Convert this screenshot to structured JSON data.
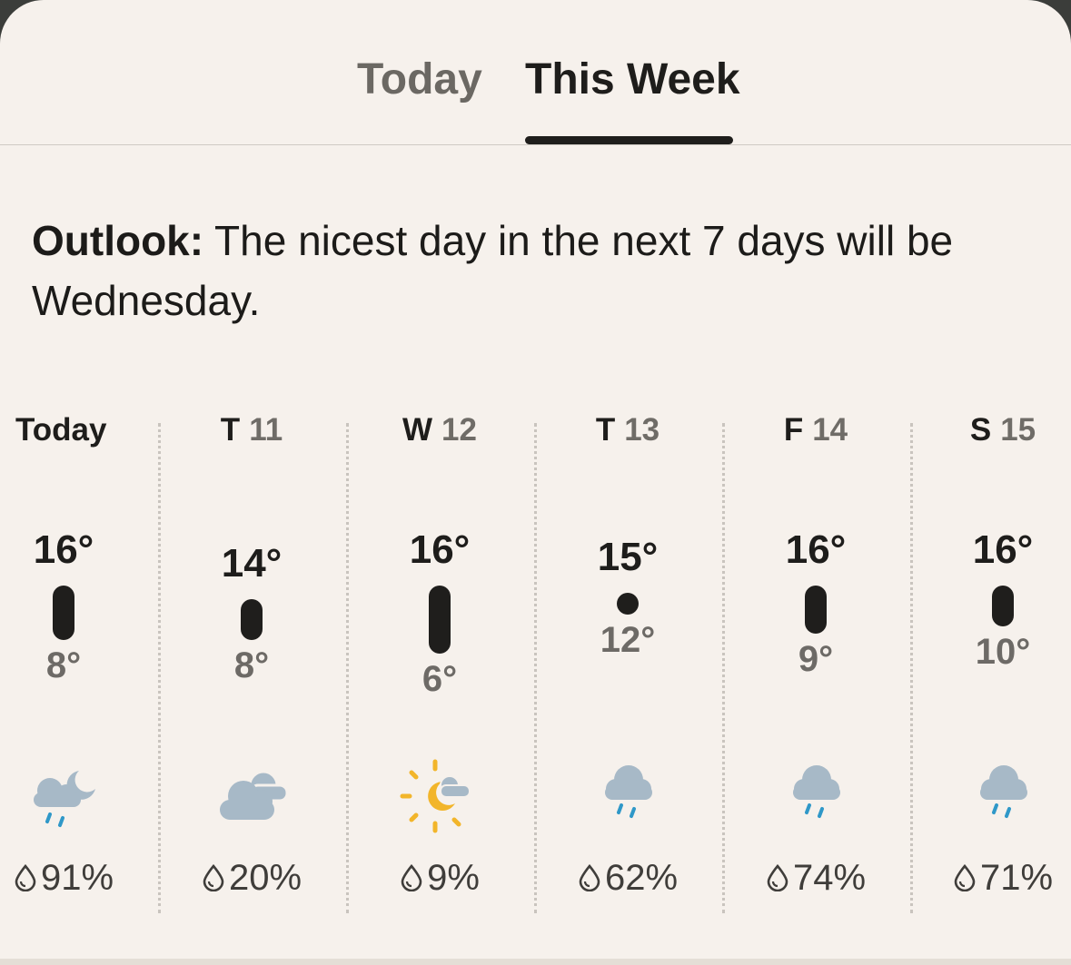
{
  "tabs": {
    "today_label": "Today",
    "week_label": "This Week",
    "active": "This Week"
  },
  "outlook": {
    "label": "Outlook:",
    "text": " The nicest day in the next 7 days will be Wednesday."
  },
  "colors": {
    "background": "#f6f1ec",
    "text": "#1e1d1b",
    "muted": "#6d6a66",
    "cloud": "#a7b9c7",
    "rain": "#2f98c8",
    "sun": "#f2b52a"
  },
  "days": [
    {
      "day": "Today",
      "date": "",
      "high": "16°",
      "low": "8°",
      "precip": "91%",
      "icon": "cloud-moon-rain-icon",
      "high_value": 16,
      "low_value": 8
    },
    {
      "day": "T",
      "date": "11",
      "high": "14°",
      "low": "8°",
      "precip": "20%",
      "icon": "clouds-icon",
      "high_value": 14,
      "low_value": 8
    },
    {
      "day": "W",
      "date": "12",
      "high": "16°",
      "low": "6°",
      "precip": "9%",
      "icon": "sun-moon-cloud-icon",
      "high_value": 16,
      "low_value": 6
    },
    {
      "day": "T",
      "date": "13",
      "high": "15°",
      "low": "12°",
      "precip": "62%",
      "icon": "cloud-rain-icon",
      "high_value": 15,
      "low_value": 12
    },
    {
      "day": "F",
      "date": "14",
      "high": "16°",
      "low": "9°",
      "precip": "74%",
      "icon": "cloud-rain-icon",
      "high_value": 16,
      "low_value": 9
    },
    {
      "day": "S",
      "date": "15",
      "high": "16°",
      "low": "10°",
      "precip": "71%",
      "icon": "cloud-rain-icon",
      "high_value": 16,
      "low_value": 10
    }
  ]
}
